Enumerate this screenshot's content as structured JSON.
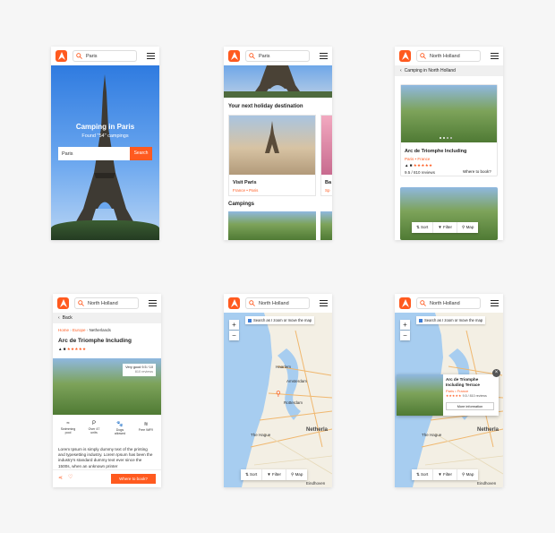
{
  "brand": {
    "accent": "#ff5a1f",
    "map_water": "#a7cdf0"
  },
  "screen1": {
    "search_value": "Paris",
    "hero_title": "Camping in Paris",
    "hero_subtitle": "Found \"54\" campings",
    "hero_input_value": "Paris",
    "hero_button": "Search"
  },
  "screen2": {
    "search_value": "Paris",
    "section_title": "Your next holiday destination",
    "card1_title": "Visit Paris",
    "card1_sub": "France • Paris",
    "card2_title": "Ba",
    "card2_sub": "Sp",
    "campings_title": "Campings"
  },
  "screen3": {
    "search_value": "North Holland",
    "breadcrumb": "Camping in North Holland",
    "card_title": "Arc de Triomphe Including",
    "card_location": "Paris • France",
    "rating": "9.5 / 810 reviews",
    "book_link": "Where to book?",
    "sort": "Sort",
    "filter": "Filter",
    "map": "Map"
  },
  "screen4": {
    "search_value": "North Holland",
    "back": "Back",
    "crumb_home": "Home",
    "crumb_europe": "Europe",
    "crumb_netherlands": "Netherlands",
    "title": "Arc de Triomphe Including",
    "badge_line1": "Very good 9.5 / 10",
    "badge_line2": "810 reviews",
    "amenities": [
      {
        "icon": "swimming-pool-icon",
        "glyph": "≈",
        "label": "Swimming pool"
      },
      {
        "icon": "parking-icon",
        "glyph": "P",
        "label": "Over 47 units"
      },
      {
        "icon": "dog-icon",
        "glyph": "🐾",
        "label": "Dogs allowed"
      },
      {
        "icon": "wifi-icon",
        "glyph": "≋",
        "label": "Free WiFi!"
      }
    ],
    "description": "Lorem Ipsum is simply dummy text of the printing and typesetting industry. Lorem Ipsum has been the industry's standard dummy text ever since the 1500s, when an unknown printer",
    "book_button": "Where to book?"
  },
  "screen5": {
    "search_value": "North Holland",
    "map_check": "Search as I zoom or move the map",
    "zoom_in": "+",
    "zoom_out": "−",
    "cities": {
      "amsterdam": "Amsterdam",
      "rotterdam": "Rotterdam",
      "the_hague": "The Hague",
      "netherlands": "Netherla",
      "eindhoven": "Eindhoven",
      "haarlem": "Haarlem"
    },
    "sort": "Sort",
    "filter": "Filter",
    "map": "Map"
  },
  "screen6": {
    "search_value": "North Holland",
    "map_check": "Search as I zoom or move the map",
    "zoom_in": "+",
    "zoom_out": "−",
    "popup_title": "Arc de Triomphe Including Terrace",
    "popup_location": "Paris • France",
    "popup_rating": "9.5 / 810 reviews",
    "popup_button": "More information",
    "cities": {
      "the_hague": "The Hague",
      "netherlands": "Netherla",
      "eindhoven": "Eindhoven"
    },
    "sort": "Sort",
    "filter": "Filter",
    "map": "Map"
  }
}
